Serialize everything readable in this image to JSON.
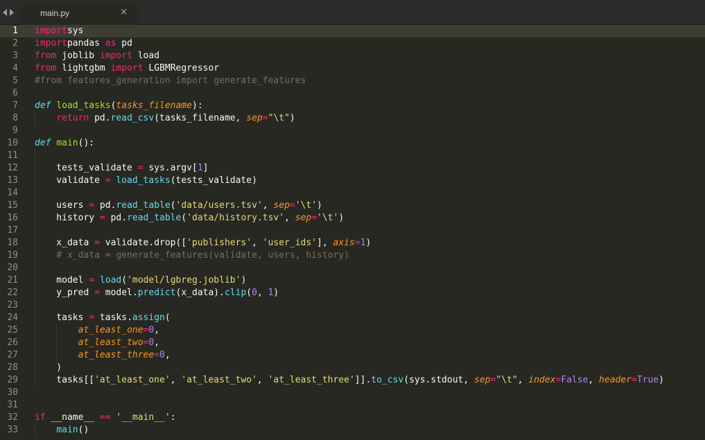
{
  "tab": {
    "filename": "main.py",
    "close_glyph": "×"
  },
  "editor": {
    "current_line": 1,
    "line_numbers": [
      "1",
      "2",
      "3",
      "4",
      "5",
      "6",
      "7",
      "8",
      "9",
      "10",
      "11",
      "12",
      "13",
      "14",
      "15",
      "16",
      "17",
      "18",
      "19",
      "20",
      "21",
      "22",
      "23",
      "24",
      "25",
      "26",
      "27",
      "28",
      "29",
      "30",
      "31",
      "32",
      "33"
    ],
    "lines": [
      [
        [
          "k",
          "import"
        ],
        [
          "",
          "sys"
        ]
      ],
      [
        [
          "k",
          "import"
        ],
        [
          "",
          "pandas "
        ],
        [
          "k",
          "as"
        ],
        [
          "",
          " pd"
        ]
      ],
      [
        [
          "k",
          "from"
        ],
        [
          "",
          " joblib "
        ],
        [
          "k",
          "import"
        ],
        [
          "",
          " load"
        ]
      ],
      [
        [
          "k",
          "from"
        ],
        [
          "",
          " lightgbm "
        ],
        [
          "k",
          "import"
        ],
        [
          "",
          " LGBMRegressor"
        ]
      ],
      [
        [
          "c",
          "#from features_generation import generate_features"
        ]
      ],
      [],
      [
        [
          "i",
          "def"
        ],
        [
          "",
          " "
        ],
        [
          "f",
          "load_tasks"
        ],
        [
          "",
          "("
        ],
        [
          "p",
          "tasks_filename"
        ],
        [
          "",
          "):"
        ]
      ],
      [
        [
          "",
          "    "
        ],
        [
          "k",
          "return"
        ],
        [
          "",
          " pd."
        ],
        [
          "b",
          "read_csv"
        ],
        [
          "",
          "(tasks_filename, "
        ],
        [
          "p",
          "sep"
        ],
        [
          "k",
          "="
        ],
        [
          "s",
          "\"\\t\""
        ],
        [
          "",
          ")"
        ]
      ],
      [],
      [
        [
          "i",
          "def"
        ],
        [
          "",
          " "
        ],
        [
          "f",
          "main"
        ],
        [
          "",
          "():"
        ]
      ],
      [],
      [
        [
          "",
          "    tests_validate "
        ],
        [
          "k",
          "="
        ],
        [
          "",
          " sys.argv["
        ],
        [
          "n",
          "1"
        ],
        [
          "",
          "]"
        ]
      ],
      [
        [
          "",
          "    validate "
        ],
        [
          "k",
          "="
        ],
        [
          "",
          " "
        ],
        [
          "b",
          "load_tasks"
        ],
        [
          "",
          "(tests_validate)"
        ]
      ],
      [],
      [
        [
          "",
          "    users "
        ],
        [
          "k",
          "="
        ],
        [
          "",
          " pd."
        ],
        [
          "b",
          "read_table"
        ],
        [
          "",
          "("
        ],
        [
          "s",
          "'data/users.tsv'"
        ],
        [
          "",
          ", "
        ],
        [
          "p",
          "sep"
        ],
        [
          "k",
          "="
        ],
        [
          "s",
          "'\\t'"
        ],
        [
          "",
          ")"
        ]
      ],
      [
        [
          "",
          "    history "
        ],
        [
          "k",
          "="
        ],
        [
          "",
          " pd."
        ],
        [
          "b",
          "read_table"
        ],
        [
          "",
          "("
        ],
        [
          "s",
          "'data/history.tsv'"
        ],
        [
          "",
          ", "
        ],
        [
          "p",
          "sep"
        ],
        [
          "k",
          "="
        ],
        [
          "s",
          "'\\t'"
        ],
        [
          "",
          ")"
        ]
      ],
      [],
      [
        [
          "",
          "    x_data "
        ],
        [
          "k",
          "="
        ],
        [
          "",
          " validate.drop(["
        ],
        [
          "s",
          "'publishers'"
        ],
        [
          "",
          ", "
        ],
        [
          "s",
          "'user_ids'"
        ],
        [
          "",
          "], "
        ],
        [
          "p",
          "axis"
        ],
        [
          "k",
          "="
        ],
        [
          "n",
          "1"
        ],
        [
          "",
          ")"
        ]
      ],
      [
        [
          "",
          "    "
        ],
        [
          "c",
          "# x_data = generate_features(validate, users, history)"
        ]
      ],
      [],
      [
        [
          "",
          "    model "
        ],
        [
          "k",
          "="
        ],
        [
          "",
          " "
        ],
        [
          "b",
          "load"
        ],
        [
          "",
          "("
        ],
        [
          "s",
          "'model/lgbreg.joblib'"
        ],
        [
          "",
          ")"
        ]
      ],
      [
        [
          "",
          "    y_pred "
        ],
        [
          "k",
          "="
        ],
        [
          "",
          " model."
        ],
        [
          "b",
          "predict"
        ],
        [
          "",
          "(x_data)."
        ],
        [
          "b",
          "clip"
        ],
        [
          "",
          "("
        ],
        [
          "n",
          "0"
        ],
        [
          "",
          ", "
        ],
        [
          "n",
          "1"
        ],
        [
          "",
          ")"
        ]
      ],
      [],
      [
        [
          "",
          "    tasks "
        ],
        [
          "k",
          "="
        ],
        [
          "",
          " tasks."
        ],
        [
          "b",
          "assign"
        ],
        [
          "",
          "("
        ]
      ],
      [
        [
          "",
          "        "
        ],
        [
          "p",
          "at_least_one"
        ],
        [
          "k",
          "="
        ],
        [
          "n",
          "0"
        ],
        [
          "",
          ","
        ]
      ],
      [
        [
          "",
          "        "
        ],
        [
          "p",
          "at_least_two"
        ],
        [
          "k",
          "="
        ],
        [
          "n",
          "0"
        ],
        [
          "",
          ","
        ]
      ],
      [
        [
          "",
          "        "
        ],
        [
          "p",
          "at_least_three"
        ],
        [
          "k",
          "="
        ],
        [
          "n",
          "0"
        ],
        [
          "",
          ","
        ]
      ],
      [
        [
          "",
          "    )"
        ]
      ],
      [
        [
          "",
          "    tasks[["
        ],
        [
          "s",
          "'at_least_one'"
        ],
        [
          "",
          ", "
        ],
        [
          "s",
          "'at_least_two'"
        ],
        [
          "",
          ", "
        ],
        [
          "s",
          "'at_least_three'"
        ],
        [
          "",
          "]]."
        ],
        [
          "b",
          "to_csv"
        ],
        [
          "",
          "(sys.stdout, "
        ],
        [
          "p",
          "sep"
        ],
        [
          "k",
          "="
        ],
        [
          "s",
          "\"\\t\""
        ],
        [
          "",
          ", "
        ],
        [
          "p",
          "index"
        ],
        [
          "k",
          "="
        ],
        [
          "n",
          "False"
        ],
        [
          "",
          ", "
        ],
        [
          "p",
          "header"
        ],
        [
          "k",
          "="
        ],
        [
          "n",
          "True"
        ],
        [
          "",
          ")"
        ]
      ],
      [],
      [],
      [
        [
          "k",
          "if"
        ],
        [
          "",
          " __name__ "
        ],
        [
          "k",
          "=="
        ],
        [
          "",
          " "
        ],
        [
          "s",
          "'__main__'"
        ],
        [
          "",
          ":"
        ]
      ],
      [
        [
          "",
          "    "
        ],
        [
          "b",
          "main"
        ],
        [
          "",
          "()"
        ]
      ]
    ]
  },
  "colors": {
    "background": "#272822",
    "keyword": "#f92672",
    "string": "#e6db74",
    "function": "#a6e22e",
    "builtin": "#66d9ef",
    "parameter": "#fd971f",
    "number": "#ae81ff",
    "comment": "#75715e"
  }
}
